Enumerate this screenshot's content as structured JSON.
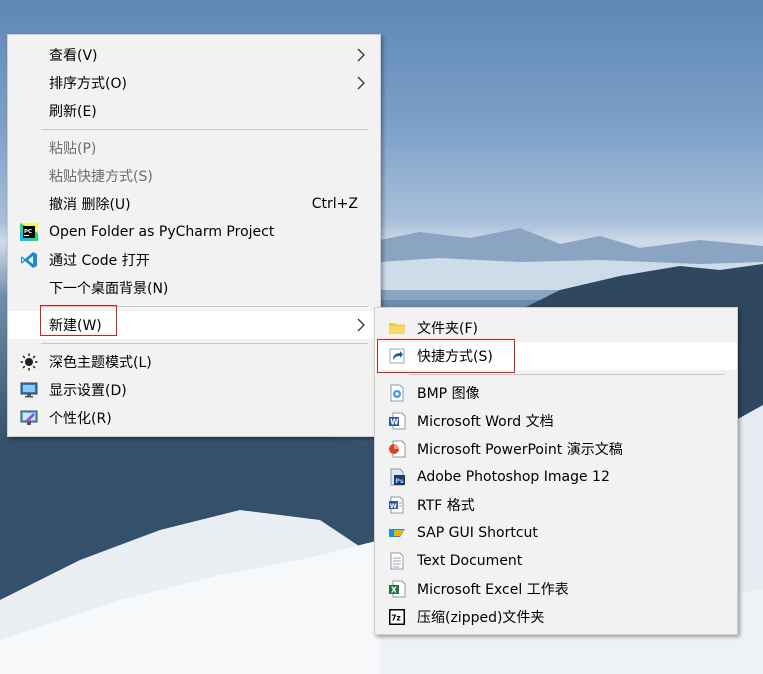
{
  "context_menu": {
    "items": [
      {
        "label": "查看(V)"
      },
      {
        "label": "排序方式(O)"
      },
      {
        "label": "刷新(E)"
      },
      {
        "label": "粘贴(P)"
      },
      {
        "label": "粘贴快捷方式(S)"
      },
      {
        "label": "撤消 删除(U)",
        "shortcut": "Ctrl+Z"
      },
      {
        "label": "Open Folder as PyCharm Project"
      },
      {
        "label": "通过 Code 打开"
      },
      {
        "label": "下一个桌面背景(N)"
      },
      {
        "label": "新建(W)"
      },
      {
        "label": "深色主题模式(L)"
      },
      {
        "label": "显示设置(D)"
      },
      {
        "label": "个性化(R)"
      }
    ]
  },
  "new_submenu": {
    "items": [
      {
        "label": "文件夹(F)"
      },
      {
        "label": "快捷方式(S)"
      },
      {
        "label": "BMP 图像"
      },
      {
        "label": "Microsoft Word 文档"
      },
      {
        "label": "Microsoft PowerPoint 演示文稿"
      },
      {
        "label": "Adobe Photoshop Image 12"
      },
      {
        "label": "RTF 格式"
      },
      {
        "label": "SAP GUI Shortcut"
      },
      {
        "label": "Text Document"
      },
      {
        "label": "Microsoft Excel 工作表"
      },
      {
        "label": "压缩(zipped)文件夹"
      }
    ]
  },
  "icon_text": {
    "pycharm": "PC",
    "photoshop": "Ps",
    "word": "W",
    "excel": "X",
    "zip": "7z"
  },
  "colors": {
    "menu_bg": "#f2f2f2",
    "highlight_box": "#d0201d",
    "disabled_text": "#6d6d6d"
  }
}
